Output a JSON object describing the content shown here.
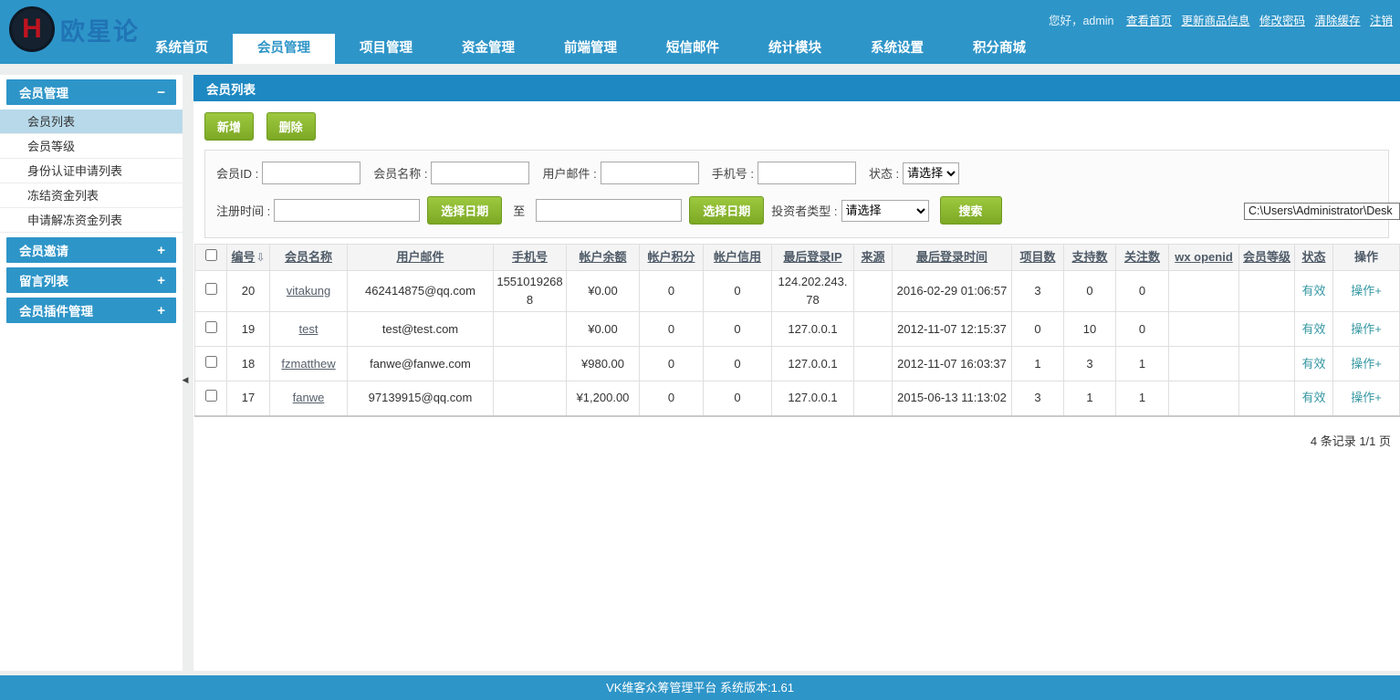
{
  "header": {
    "logo": {
      "monogram": "H",
      "text": "欧星论"
    },
    "greeting": "您好，admin",
    "top_links": [
      "查看首页",
      "更新商品信息",
      "修改密码",
      "清除缓存",
      "注销"
    ],
    "nav": [
      {
        "label": "系统首页"
      },
      {
        "label": "会员管理"
      },
      {
        "label": "项目管理"
      },
      {
        "label": "资金管理"
      },
      {
        "label": "前端管理"
      },
      {
        "label": "短信邮件"
      },
      {
        "label": "统计模块"
      },
      {
        "label": "系统设置"
      },
      {
        "label": "积分商城"
      }
    ]
  },
  "sidebar": {
    "sections": [
      {
        "label": "会员管理",
        "toggle": "−"
      },
      {
        "label": "会员邀请",
        "toggle": "+"
      },
      {
        "label": "留言列表",
        "toggle": "+"
      },
      {
        "label": "会员插件管理",
        "toggle": "+"
      }
    ],
    "member_items": [
      {
        "label": "会员列表"
      },
      {
        "label": "会员等级"
      },
      {
        "label": "身份认证申请列表"
      },
      {
        "label": "冻结资金列表"
      },
      {
        "label": "申请解冻资金列表"
      }
    ]
  },
  "panel": {
    "title": "会员列表"
  },
  "toolbar": {
    "add_label": "新增",
    "delete_label": "删除"
  },
  "search": {
    "member_id_label": "会员ID :",
    "member_name_label": "会员名称 :",
    "email_label": "用户邮件 :",
    "phone_label": "手机号 :",
    "status_label": "状态 :",
    "status_value": "请选择",
    "reg_time_label": "注册时间 :",
    "date_btn_label": "选择日期",
    "to_label": "至",
    "investor_type_label": "投资者类型 :",
    "investor_type_value": "请选择",
    "search_btn_label": "搜索"
  },
  "tooltip": {
    "text": "C:\\Users\\Administrator\\Desk"
  },
  "table": {
    "sort_icon": "⇩",
    "headers": [
      "编号",
      "会员名称",
      "用户邮件",
      "手机号",
      "帐户余额",
      "帐户积分",
      "帐户信用",
      "最后登录IP",
      "来源",
      "最后登录时间",
      "项目数",
      "支持数",
      "关注数",
      "wx openid",
      "会员等级",
      "状态",
      "操作"
    ],
    "rows": [
      {
        "id": "20",
        "name": "vitakung",
        "email": "462414875@qq.com",
        "phone": "15510192688",
        "balance": "¥0.00",
        "points": "0",
        "credit": "0",
        "last_ip": "124.202.243.78",
        "source": "",
        "last_time": "2016-02-29 01:06:57",
        "projects": "3",
        "supports": "0",
        "follows": "0",
        "wx_openid": "",
        "level": "",
        "status": "有效",
        "action": "操作+"
      },
      {
        "id": "19",
        "name": "test",
        "email": "test@test.com",
        "phone": "",
        "balance": "¥0.00",
        "points": "0",
        "credit": "0",
        "last_ip": "127.0.0.1",
        "source": "",
        "last_time": "2012-11-07 12:15:37",
        "projects": "0",
        "supports": "10",
        "follows": "0",
        "wx_openid": "",
        "level": "",
        "status": "有效",
        "action": "操作+"
      },
      {
        "id": "18",
        "name": "fzmatthew",
        "email": "fanwe@fanwe.com",
        "phone": "",
        "balance": "¥980.00",
        "points": "0",
        "credit": "0",
        "last_ip": "127.0.0.1",
        "source": "",
        "last_time": "2012-11-07 16:03:37",
        "projects": "1",
        "supports": "3",
        "follows": "1",
        "wx_openid": "",
        "level": "",
        "status": "有效",
        "action": "操作+"
      },
      {
        "id": "17",
        "name": "fanwe",
        "email": "97139915@qq.com",
        "phone": "",
        "balance": "¥1,200.00",
        "points": "0",
        "credit": "0",
        "last_ip": "127.0.0.1",
        "source": "",
        "last_time": "2015-06-13 11:13:02",
        "projects": "3",
        "supports": "1",
        "follows": "1",
        "wx_openid": "",
        "level": "",
        "status": "有效",
        "action": "操作+"
      }
    ],
    "records_summary": "4 条记录 1/1 页"
  },
  "footer": {
    "text": "VK维客众筹管理平台 系统版本:1.61"
  }
}
